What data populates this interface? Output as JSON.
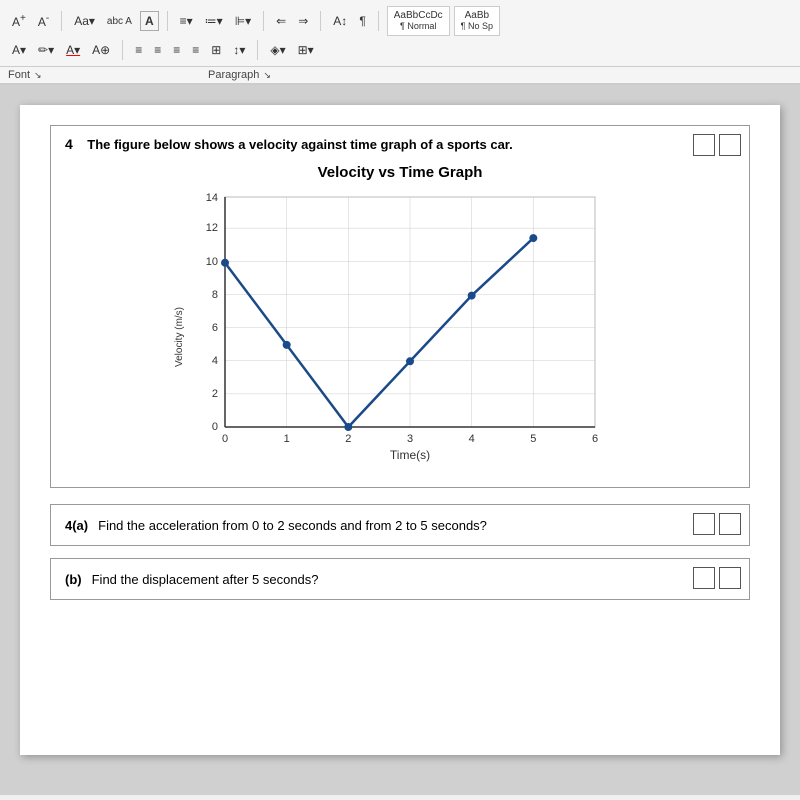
{
  "toolbar": {
    "row1_buttons": [
      "A⁺",
      "A⁻",
      "Aa▾",
      "Aᵇᶜ",
      "A"
    ],
    "row2_buttons": [
      "A▾",
      "✏▾",
      "A▾",
      "A⊕"
    ],
    "font_label": "Font",
    "paragraph_label": "Paragraph",
    "styles": [
      "AaBbCcDc",
      "AaBb"
    ],
    "style_labels": [
      "¶ Normal",
      "¶ No Sp"
    ]
  },
  "question4": {
    "number": "4",
    "text": "The figure below shows a velocity against time graph of a sports car.",
    "chart_title": "Velocity vs Time Graph",
    "x_axis_label": "Time(s)",
    "y_axis_label": "Velocity (m/s)",
    "y_label_short": "Velocity\n(m/s)",
    "x_ticks": [
      0,
      1,
      2,
      3,
      4,
      5,
      6
    ],
    "y_ticks": [
      0,
      2,
      4,
      6,
      8,
      10,
      12,
      14
    ],
    "data_points": [
      {
        "x": 0,
        "y": 10
      },
      {
        "x": 1,
        "y": 5
      },
      {
        "x": 2,
        "y": 0
      },
      {
        "x": 3,
        "y": 4
      },
      {
        "x": 4,
        "y": 8
      },
      {
        "x": 5,
        "y": 11.5
      }
    ]
  },
  "sub_questions": {
    "a": {
      "label": "4(a)",
      "text": "Find the acceleration from 0 to 2 seconds and from 2 to 5 seconds?"
    },
    "b": {
      "label": "(b)",
      "text": "Find the displacement after 5 seconds?"
    }
  }
}
